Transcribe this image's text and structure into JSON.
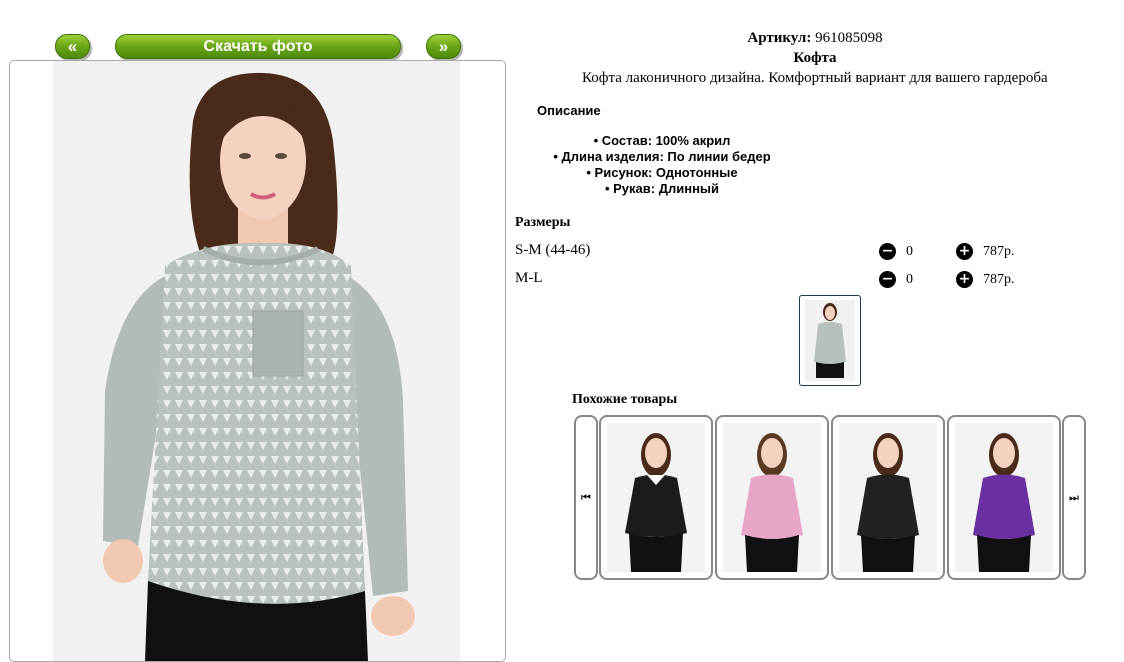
{
  "gallery": {
    "prev_label": "«",
    "download_label": "Скачать фото",
    "next_label": "»"
  },
  "product": {
    "article_label": "Артикул:",
    "article_value": "961085098",
    "name": "Кофта",
    "short_description": "Кофта лаконичного дизайна. Комфортный вариант для вашего гардероба",
    "description_title": "Описание",
    "features": [
      "• Состав: 100% акрил",
      "• Длина изделия: По линии бедер",
      "• Рисунок: Однотонные",
      "• Рукав: Длинный"
    ]
  },
  "sizes": {
    "title": "Размеры",
    "minus_icon": "minus-circle-icon",
    "plus_icon": "plus-circle-icon",
    "minus_glyph": "−",
    "plus_glyph": "+",
    "rows": [
      {
        "name": "S-M (44-46)",
        "qty": "0",
        "price": "787р."
      },
      {
        "name": "M-L",
        "qty": "0",
        "price": "787р."
      }
    ]
  },
  "similar": {
    "title": "Похожие товары",
    "prev_glyph": "⏮",
    "next_glyph": "⏭",
    "items": [
      {
        "top_color": "#1b1b1b",
        "collar_color": "#ffffff"
      },
      {
        "top_color": "#e8a6c7",
        "collar_color": "#e8a6c7"
      },
      {
        "top_color": "#222222",
        "collar_color": "#222222"
      },
      {
        "top_color": "#6a2fa0",
        "collar_color": "#6a2fa0"
      }
    ]
  },
  "colors": {
    "button_green": "#6aa516",
    "sweater": "#b8c0bd",
    "hair": "#4a2a1a"
  }
}
